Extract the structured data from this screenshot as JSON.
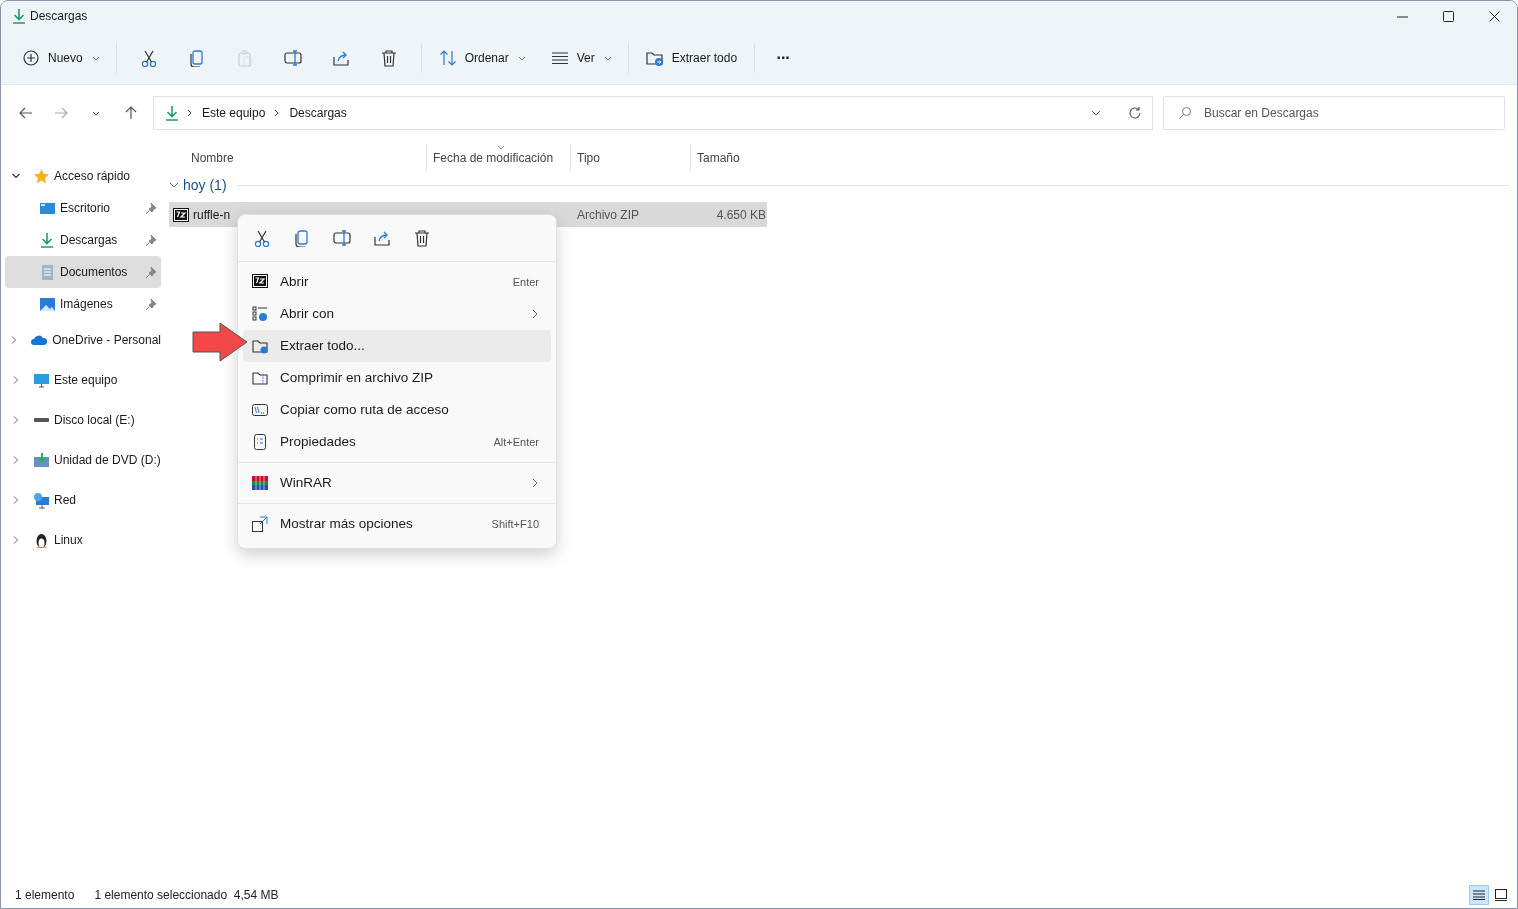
{
  "window": {
    "title": "Descargas"
  },
  "toolbar": {
    "new": "Nuevo",
    "sort": "Ordenar",
    "view": "Ver",
    "extract": "Extraer todo",
    "more": "···"
  },
  "toolbar_icons": [
    {
      "disabled": false
    },
    {
      "disabled": false
    },
    {
      "disabled": true
    },
    {
      "disabled": false
    },
    {
      "disabled": false
    },
    {
      "disabled": false
    }
  ],
  "address_bar": {
    "crumbs": [
      "Este equipo",
      "Descargas"
    ]
  },
  "search": {
    "placeholder": "Buscar en Descargas"
  },
  "sidebar": {
    "items": [
      {
        "label": "Acceso rápido",
        "expanded": true,
        "selected": false,
        "children": [
          {
            "label": "Escritorio",
            "pinned": true,
            "selected": false
          },
          {
            "label": "Descargas",
            "pinned": true,
            "selected": false
          },
          {
            "label": "Documentos",
            "pinned": true,
            "selected": true
          },
          {
            "label": "Imágenes",
            "pinned": true,
            "selected": false
          }
        ]
      },
      {
        "label": "OneDrive - Personal",
        "expanded": false,
        "selected": false
      },
      {
        "label": "Este equipo",
        "expanded": false,
        "selected": false
      },
      {
        "label": "Disco local (E:)",
        "expanded": false,
        "selected": false
      },
      {
        "label": "Unidad de DVD (D:)",
        "expanded": false,
        "selected": false
      },
      {
        "label": "Red",
        "expanded": false,
        "selected": false
      },
      {
        "label": "Linux",
        "expanded": false,
        "selected": false
      }
    ]
  },
  "table": {
    "columns": [
      "Nombre",
      "Fecha de modificación",
      "Tipo",
      "Tamaño"
    ],
    "groups": [
      {
        "label": "hoy (1)",
        "expanded": true,
        "rows": [
          {
            "name": "ruffle-n",
            "type": "Archivo ZIP",
            "size": "4.650 KB",
            "selected": true
          }
        ]
      }
    ]
  },
  "context_menu": {
    "groups": [
      [
        {
          "label": "Abrir",
          "shortcut": "Enter",
          "submenu": false,
          "selected": false
        },
        {
          "label": "Abrir con",
          "submenu": true,
          "selected": false
        },
        {
          "label": "Extraer todo...",
          "submenu": false,
          "selected": true
        },
        {
          "label": "Comprimir en archivo ZIP",
          "submenu": false,
          "selected": false
        },
        {
          "label": "Copiar como ruta de acceso",
          "submenu": false,
          "selected": false
        },
        {
          "label": "Propiedades",
          "shortcut": "Alt+Enter",
          "submenu": false,
          "selected": false
        }
      ],
      [
        {
          "label": "WinRAR",
          "submenu": true,
          "selected": false
        }
      ],
      [
        {
          "label": "Mostrar más opciones",
          "shortcut": "Shift+F10",
          "submenu": false,
          "selected": false
        }
      ]
    ]
  },
  "status_bar": {
    "count": "1 elemento",
    "selection": "1 elemento seleccionado  4,54 MB"
  }
}
